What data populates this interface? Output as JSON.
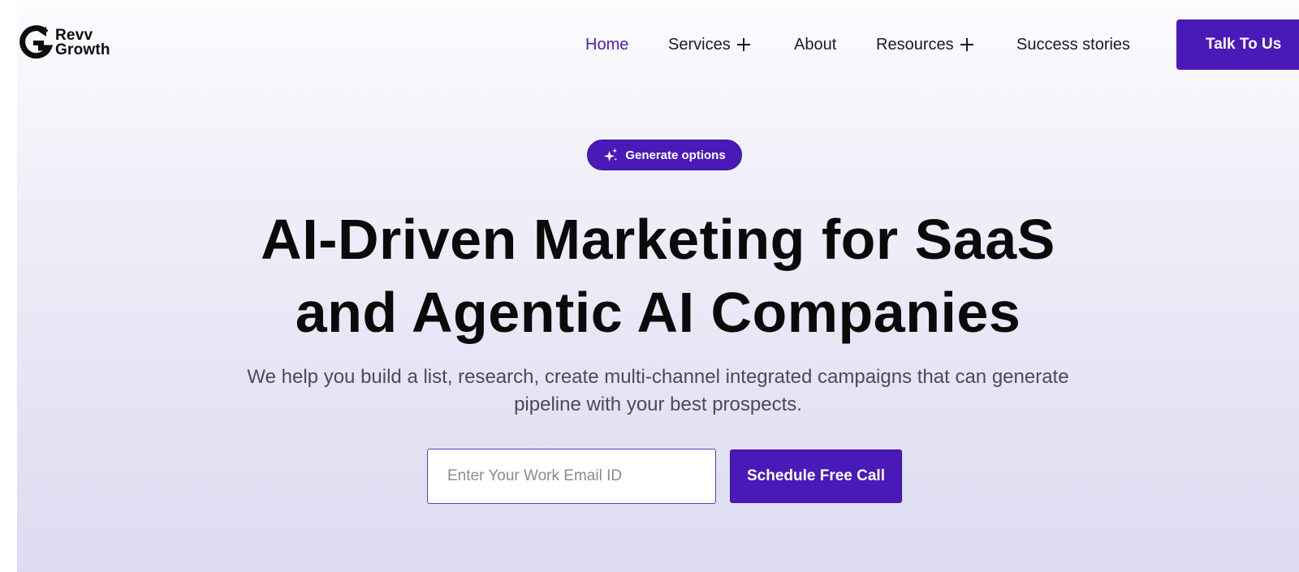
{
  "brand": {
    "line1": "Revv",
    "line2": "Growth",
    "accent": "#4a1ab8"
  },
  "nav": {
    "items": [
      {
        "label": "Home",
        "active": true,
        "has_submenu": false
      },
      {
        "label": "Services",
        "active": false,
        "has_submenu": true
      },
      {
        "label": "About",
        "active": false,
        "has_submenu": false
      },
      {
        "label": "Resources",
        "active": false,
        "has_submenu": true
      },
      {
        "label": "Success stories",
        "active": false,
        "has_submenu": false
      }
    ],
    "cta_label": "Talk To Us"
  },
  "hero": {
    "badge_label": "Generate options",
    "badge_icon": "sparkle-icon",
    "headline_line1": "AI-Driven Marketing for SaaS",
    "headline_line2": "and Agentic AI Companies",
    "subtitle_line1": "We help you build a list, research, create multi-channel integrated campaigns that can generate",
    "subtitle_line2": "pipeline with your best prospects."
  },
  "form": {
    "email_placeholder": "Enter Your Work Email ID",
    "email_value": "",
    "submit_label": "Schedule Free Call"
  }
}
